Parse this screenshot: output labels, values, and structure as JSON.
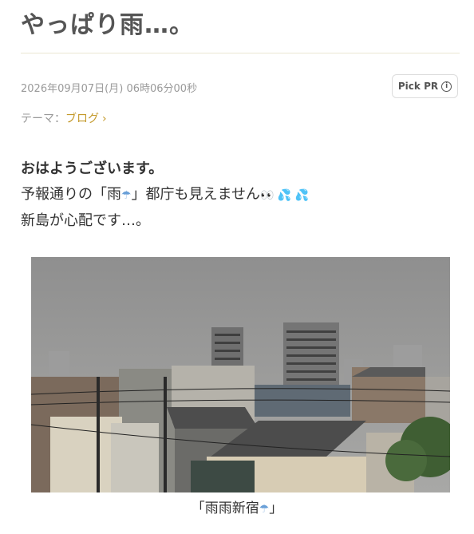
{
  "post": {
    "title": "やっぱり雨…。",
    "date": "2026年09月07日(月) 06時06分00秒",
    "pick_pr_label": "Pick PR",
    "theme_label": "テーマ：",
    "theme_link": "ブログ",
    "greeting": "おはようございます。",
    "line2_before": "予報通りの「雨",
    "line2_after": "」都庁も見えません",
    "line3": "新島が心配です…。",
    "caption_before": "「雨雨新宿",
    "caption_after": "」"
  },
  "colors": {
    "accent": "#c49a2c",
    "title": "#555555",
    "meta": "#9a9a9a"
  },
  "icons": {
    "info": "info-circle-icon",
    "chevron": "chevron-right-icon",
    "umbrella": "umbrella-rain-icon",
    "eyes": "eyes-icon",
    "droplets": "sweat-droplets-icon"
  }
}
